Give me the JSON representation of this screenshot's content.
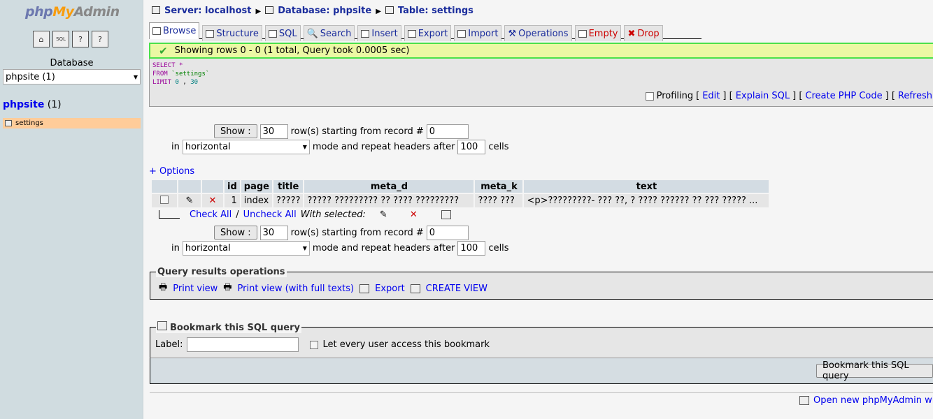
{
  "left": {
    "logo": {
      "php": "php",
      "my": "My",
      "admin": "Admin"
    },
    "icons": [
      "home-icon",
      "sql-window-icon",
      "help-icon",
      "docs-icon"
    ],
    "database_label": "Database",
    "database_select": "phpsite (1)",
    "db_name": "phpsite",
    "db_count": "(1)",
    "tables": [
      {
        "label": "settings"
      }
    ]
  },
  "breadcrumb": {
    "server": "Server: localhost",
    "database": "Database: phpsite",
    "table": "Table: settings"
  },
  "tabs": [
    {
      "label": "Browse",
      "icon": "browse-icon"
    },
    {
      "label": "Structure",
      "icon": "structure-icon"
    },
    {
      "label": "SQL",
      "icon": "sql-icon"
    },
    {
      "label": "Search",
      "icon": "search-icon"
    },
    {
      "label": "Insert",
      "icon": "insert-icon"
    },
    {
      "label": "Export",
      "icon": "export-icon"
    },
    {
      "label": "Import",
      "icon": "import-icon"
    },
    {
      "label": "Operations",
      "icon": "operations-icon"
    },
    {
      "label": "Empty",
      "icon": "empty-icon"
    },
    {
      "label": "Drop",
      "icon": "drop-icon"
    }
  ],
  "status": {
    "message": "Showing rows 0 - 0 (1 total, Query took 0.0005 sec)"
  },
  "sql": {
    "select": "SELECT",
    "star": "*",
    "from": "FROM",
    "table": "`settings`",
    "limit": "LIMIT",
    "offset": "0",
    "comma": ",",
    "count": "30"
  },
  "sql_tools": {
    "profiling": "Profiling",
    "edit": "Edit",
    "explain": "Explain SQL",
    "php": "Create PHP Code",
    "refresh": "Refresh"
  },
  "navigation": {
    "show_button": "Show :",
    "rows_value": "30",
    "rows_label": "row(s) starting from record #",
    "start_value": "0",
    "in_label": "in",
    "mode_value": "horizontal",
    "repeat_label": "mode and repeat headers after",
    "repeat_value": "100",
    "cells_label": "cells"
  },
  "options_link": "+ Options",
  "table": {
    "headers": [
      "id",
      "page",
      "title",
      "meta_d",
      "meta_k",
      "text"
    ],
    "row": {
      "id": "1",
      "page": "index",
      "title": "?????",
      "meta_d": "????? ????????? ?? ???? ?????????",
      "meta_k": "???? ???",
      "text": "<p>?????????- ??? ??, ? ???? ?????? ?? ??? ????? ..."
    }
  },
  "bulk": {
    "check_all": "Check All",
    "slash": "/",
    "uncheck_all": "Uncheck All",
    "with_selected": "With selected:"
  },
  "query_ops": {
    "legend": "Query results operations",
    "print_view": "Print view",
    "print_full": "Print view (with full texts)",
    "export": "Export",
    "create_view": "CREATE VIEW"
  },
  "bookmark": {
    "legend": "Bookmark this SQL query",
    "label": "Label:",
    "label_value": "",
    "every_user": "Let every user access this bookmark",
    "button": "Bookmark this SQL query"
  },
  "footer": {
    "new_window": "Open new phpMyAdmin window"
  }
}
